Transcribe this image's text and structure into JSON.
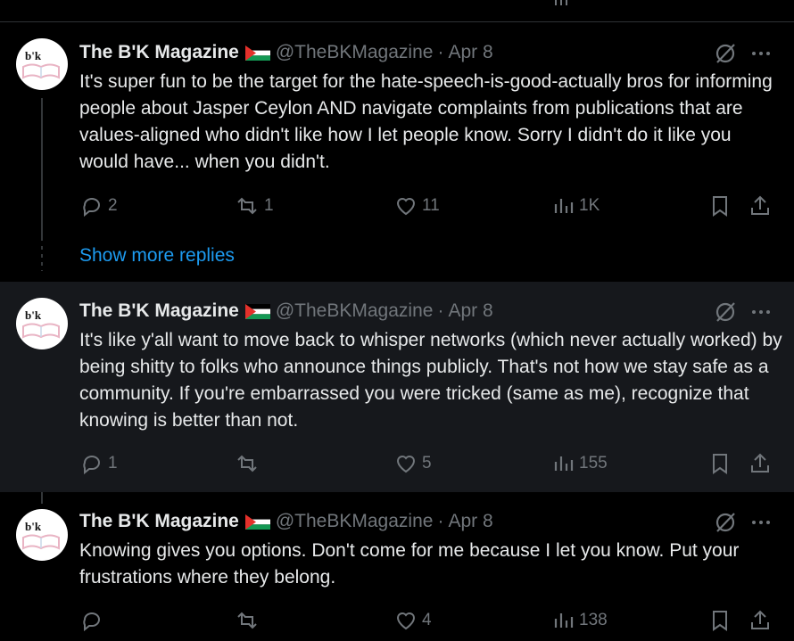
{
  "tweets": [
    {
      "name": "The B'K Magazine",
      "handle": "@TheBKMagazine",
      "separator": "·",
      "date": "Apr 8",
      "text": "It's super fun to be the target for the hate-speech-is-good-actually bros for informing people about Jasper Ceylon AND navigate complaints from publications that are values-aligned who didn't like how I let people know. Sorry I didn't do it like you would have... when you didn't.",
      "replies": "2",
      "reposts": "1",
      "likes": "11",
      "views": "1K"
    },
    {
      "name": "The B'K Magazine",
      "handle": "@TheBKMagazine",
      "separator": "·",
      "date": "Apr 8",
      "text": "It's like y'all want to move back to whisper networks (which never actually worked) by being shitty to folks who announce things publicly. That's not how we stay safe as a community. If you're embarrassed you were tricked (same as me), recognize that knowing is better than not.",
      "replies": "1",
      "reposts": "",
      "likes": "5",
      "views": "155"
    },
    {
      "name": "The B'K Magazine",
      "handle": "@TheBKMagazine",
      "separator": "·",
      "date": "Apr 8",
      "text": "Knowing gives you options. Don't come for me because I let you know. Put your frustrations where they belong.",
      "replies": "",
      "reposts": "",
      "likes": "4",
      "views": "138"
    }
  ],
  "show_more_replies": "Show more replies",
  "avatar_logo_text": "b'k",
  "icons": [
    "reply-icon",
    "repost-icon",
    "like-icon",
    "views-icon",
    "bookmark-icon",
    "share-icon",
    "grok-icon",
    "more-icon",
    "palestine-flag-icon"
  ],
  "colors": {
    "background": "#000000",
    "highlight": "#16181c",
    "text": "#e7e9ea",
    "muted": "#71767b",
    "link": "#1d9bf0",
    "divider": "#2f3336"
  }
}
